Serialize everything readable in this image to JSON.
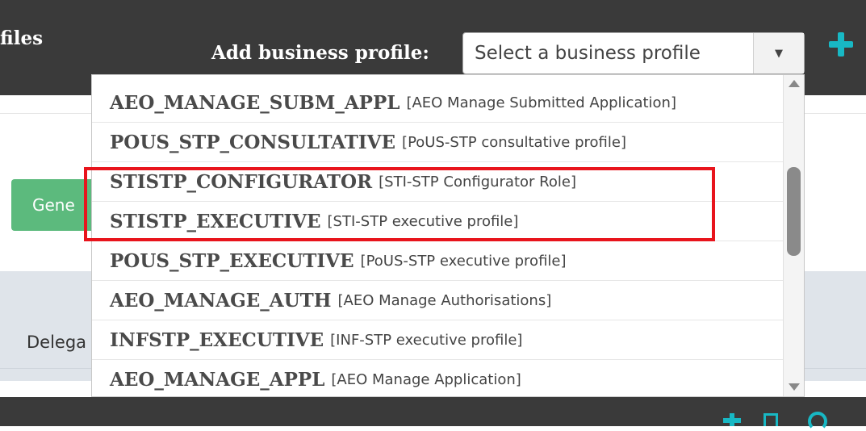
{
  "header": {
    "title_fragment": "files",
    "add_label": "Add business profile:",
    "select": {
      "placeholder": "Select a business profile"
    },
    "add_icon": "plus-icon"
  },
  "main": {
    "green_button_label": "Gene",
    "delegation_label": "Delega"
  },
  "dropdown": {
    "options": [
      {
        "code": "AEO_MANAGE_SUBM_APPL",
        "desc": "[AEO Manage Submitted Application]"
      },
      {
        "code": "POUS_STP_CONSULTATIVE",
        "desc": "[PoUS-STP consultative profile]"
      },
      {
        "code": "STISTP_CONFIGURATOR",
        "desc": "[STI-STP Configurator Role]"
      },
      {
        "code": "STISTP_EXECUTIVE",
        "desc": "[STI-STP executive profile]"
      },
      {
        "code": "POUS_STP_EXECUTIVE",
        "desc": "[PoUS-STP executive profile]"
      },
      {
        "code": "AEO_MANAGE_AUTH",
        "desc": "[AEO Manage Authorisations]"
      },
      {
        "code": "INFSTP_EXECUTIVE",
        "desc": "[INF-STP executive profile]"
      },
      {
        "code": "AEO_MANAGE_APPL",
        "desc": "[AEO Manage Application]"
      }
    ]
  },
  "footer": {
    "icons": [
      "plus-icon",
      "document-icon",
      "refresh-icon"
    ]
  },
  "colors": {
    "topbar": "#3a3a3a",
    "accent": "#18b8c4",
    "button_green": "#5cba7d",
    "highlight_red": "#e8141c"
  }
}
